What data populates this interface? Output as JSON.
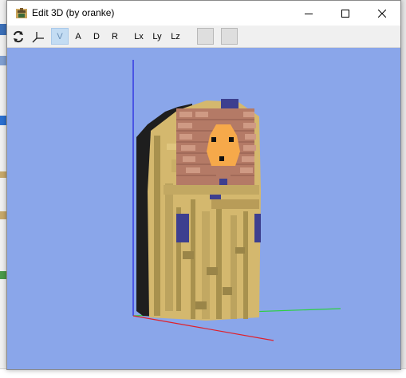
{
  "window": {
    "title": "Edit 3D (by oranke)"
  },
  "toolbar": {
    "refresh_icon": "rotate-arrows-icon",
    "axes_icon": "axes-icon",
    "buttons": [
      {
        "label": "V",
        "active": true
      },
      {
        "label": "A",
        "active": false
      },
      {
        "label": "D",
        "active": false
      },
      {
        "label": "R",
        "active": false
      },
      {
        "label": "Lx",
        "active": false
      },
      {
        "label": "Ly",
        "active": false
      },
      {
        "label": "Lz",
        "active": false
      }
    ]
  },
  "viewport": {
    "background_color": "#8aa6ea",
    "axis_colors": {
      "x": "#e0202a",
      "y": "#2cd040",
      "z": "#2020e0"
    },
    "model_colors": {
      "gold": "#d4b86e",
      "gold_dark": "#a8914e",
      "black": "#1e1e1e",
      "brick": "#b47a66",
      "brick_light": "#cf9a84",
      "navy": "#3d3f8f",
      "face": "#f6a94a"
    }
  }
}
